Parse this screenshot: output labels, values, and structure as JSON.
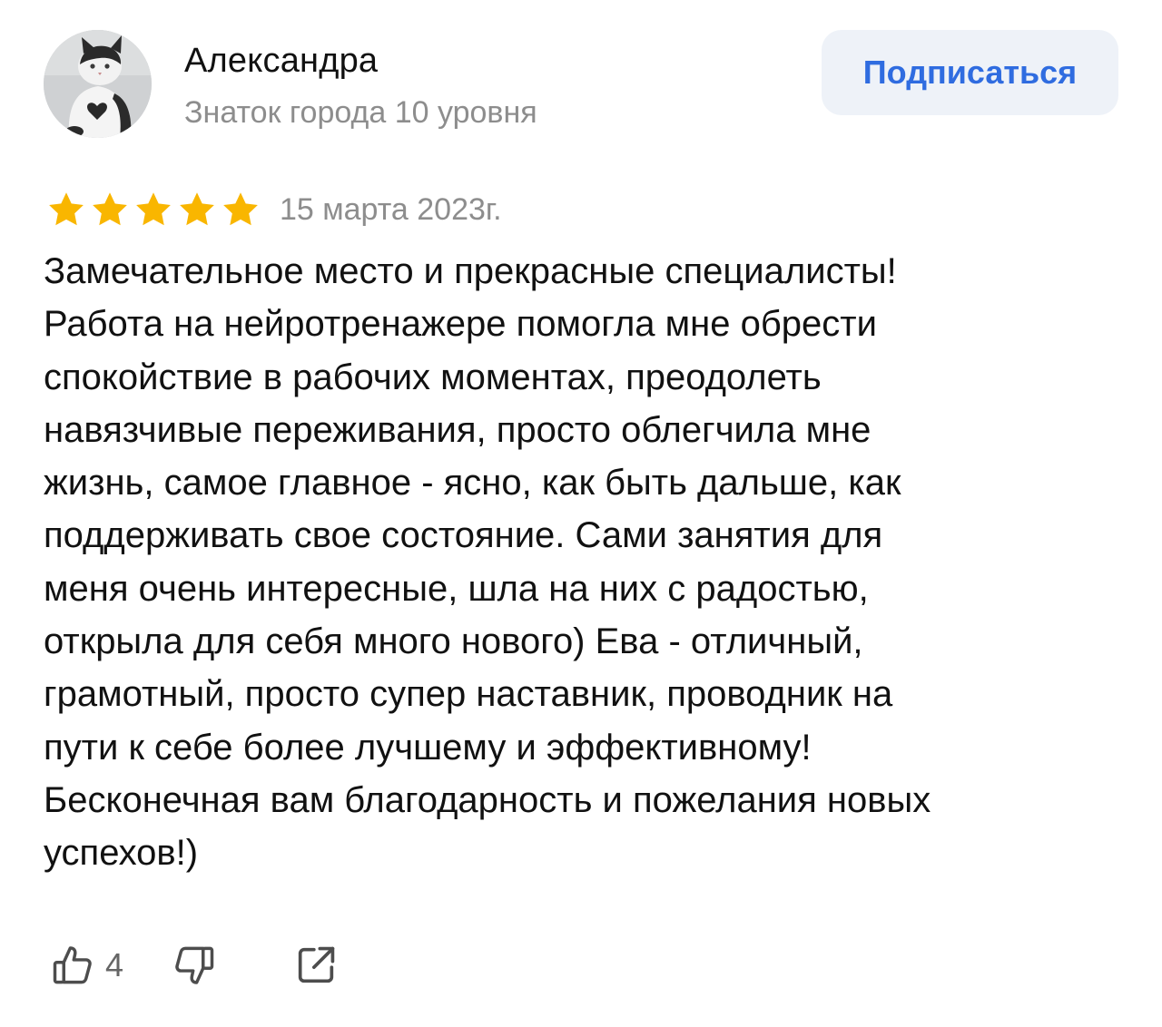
{
  "author": {
    "name": "Александра",
    "level": "Знаток города 10 уровня",
    "avatar_icon": "cat-avatar"
  },
  "subscribe": {
    "label": "Подписаться"
  },
  "rating": {
    "stars": 5,
    "max": 5,
    "star_color": "#f9b600",
    "date": "15 марта 2023г."
  },
  "review": {
    "lines": [
      "Замечательное место и прекрасные специалисты!",
      "Работа на нейротренажере помогла мне обрести",
      "спокойствие в рабочих моментах, преодолеть",
      "навязчивые переживания, просто облегчила мне",
      "жизнь, самое главное - ясно, как быть дальше, как",
      "поддерживать свое состояние. Сами занятия для",
      "меня очень интересные, шла на них с радостью,",
      "открыла для себя много нового) Ева - отличный,",
      "грамотный, просто супер наставник, проводник на",
      "пути к себе более лучшему и эффективному!",
      "Бесконечная вам благодарность и пожелания новых",
      "успехов!)"
    ]
  },
  "actions": {
    "like_icon": "thumbs-up-icon",
    "like_count": "4",
    "dislike_icon": "thumbs-down-icon",
    "share_icon": "share-icon"
  },
  "colors": {
    "accent": "#2f6ce0",
    "button_bg": "#eef2f8",
    "muted_text": "#8d8d8d"
  }
}
